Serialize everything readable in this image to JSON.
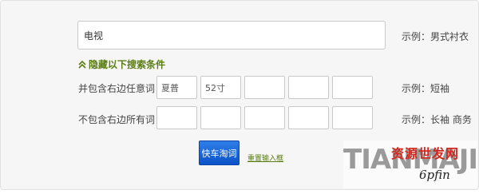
{
  "search": {
    "main_value": "电视",
    "main_example": "示例：男式衬衣"
  },
  "toggle": {
    "label": "隐藏以下搜索条件",
    "icon": "double-chevron-up-icon",
    "color": "#5a7d12"
  },
  "include_row": {
    "label": "并包含右边任意词：",
    "values": [
      "夏普",
      "52寸",
      "",
      "",
      ""
    ],
    "example": "示例：短袖"
  },
  "exclude_row": {
    "label": "不包含右边所有词：",
    "values": [
      "",
      "",
      "",
      "",
      ""
    ],
    "example": "示例：长袖 商务"
  },
  "actions": {
    "search_label": "快车淘词",
    "reset_label": "重置输入框",
    "search_color": "#1a66d8"
  },
  "watermark": {
    "logo_text": "TIANMAJIE",
    "cn_text": "资源世发网",
    "url": "6pfin"
  }
}
